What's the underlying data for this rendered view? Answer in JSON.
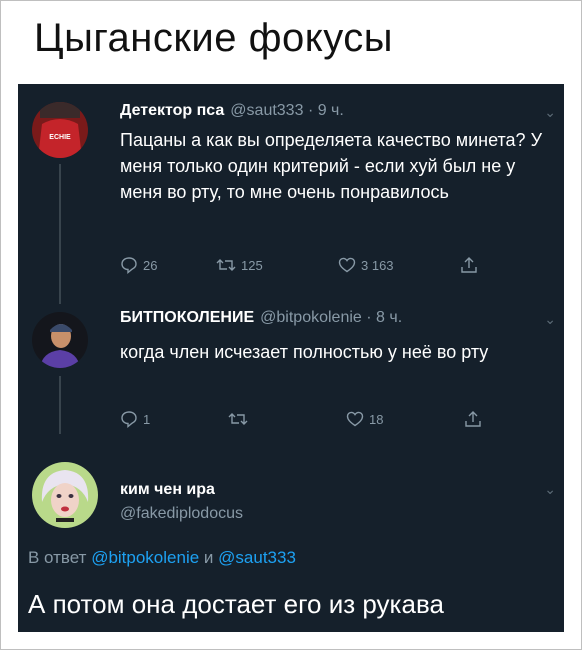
{
  "meme_title": "Цыганские  фокусы",
  "tweets": [
    {
      "name": "Детектор пса",
      "handle": "@saut333",
      "time": "· 9 ч.",
      "text": "Пацаны а как вы определяета качество минета? У меня только один критерий - если хуй был не у меня во рту, то мне очень понравилось",
      "replies": "26",
      "retweets": "125",
      "likes": "3 163",
      "avatar_colors": {
        "bg": "#7a1a1a",
        "shirt": "#c4242a",
        "text": "#ffffff"
      },
      "avatar_label": "ECHIE"
    },
    {
      "name": "БИТПОКОЛЕНИЕ",
      "handle": "@bitpokolenie",
      "time": "· 8 ч.",
      "text": "когда член исчезает полностью у неё во рту",
      "replies": "1",
      "retweets": "",
      "likes": "18",
      "avatar_colors": {
        "bg": "#14161c",
        "shirt": "#5b3fa6",
        "skin": "#c8906a",
        "cap": "#3a4a6a"
      }
    },
    {
      "name": "ким чен ира",
      "handle": "@fakediplodocus",
      "avatar_colors": {
        "bg": "#b9d98a",
        "hair": "#e9e4f0",
        "skin": "#f0d3c8",
        "lips": "#c0303f"
      }
    }
  ],
  "reply_to": {
    "prefix": "В ответ",
    "user1": "@bitpokolenie",
    "conj": "и",
    "user2": "@saut333"
  },
  "main_text": "А потом она достает его из рукава",
  "icons": [
    "reply-icon",
    "retweet-icon",
    "like-icon",
    "share-icon",
    "chevron-down-icon"
  ],
  "colors": {
    "background": "#15202b",
    "text": "#ffffff",
    "muted": "#8899a6",
    "link": "#1da1f2"
  }
}
